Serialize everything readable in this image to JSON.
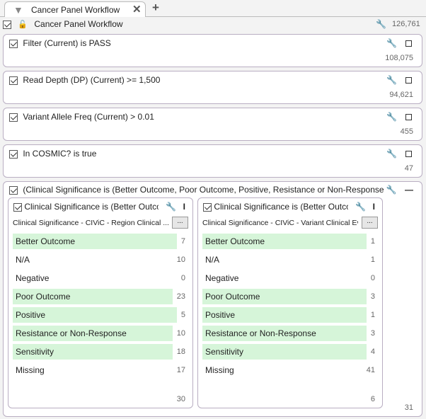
{
  "tab": {
    "title": "Cancer Panel Workflow",
    "close": "✕",
    "add": "+"
  },
  "root": {
    "label": "Cancer Panel Workflow",
    "count": "126,761"
  },
  "filters": [
    {
      "label": "Filter (Current) is PASS",
      "count": "108,075"
    },
    {
      "label": "Read Depth (DP) (Current) >= 1,500",
      "count": "94,621"
    },
    {
      "label": "Variant Allele Freq (Current) > 0.01",
      "count": "455"
    },
    {
      "label": "In COSMIC? is true",
      "count": "47"
    }
  ],
  "group": {
    "label": "(Clinical Significance is (Better Outcome, Poor Outcome, Positive, Resistance or Non-Response",
    "count": "31",
    "panels": [
      {
        "title": "Clinical Significance is (Better Outcome, Poor Outcome, Positive, Resistance or Non-Response, Sensitivity)",
        "field": "Clinical Significance - CIViC - Region Clinical ...",
        "more": "...",
        "total": "30",
        "rows": [
          {
            "label": "Better Outcome",
            "count": "7",
            "selected": true
          },
          {
            "label": "N/A",
            "count": "10",
            "selected": false
          },
          {
            "label": "Negative",
            "count": "0",
            "selected": false
          },
          {
            "label": "Poor Outcome",
            "count": "23",
            "selected": true
          },
          {
            "label": "Positive",
            "count": "5",
            "selected": true
          },
          {
            "label": "Resistance or Non-Response",
            "count": "10",
            "selected": true
          },
          {
            "label": "Sensitivity",
            "count": "18",
            "selected": true
          },
          {
            "label": "Missing",
            "count": "17",
            "selected": false
          }
        ]
      },
      {
        "title": "Clinical Significance is (Better Outcome, Poor Outcome, Positive, Resistance or Non-Response, Sensitivity)",
        "field": "Clinical Significance - CIViC - Variant Clinical Evidence...",
        "more": "...",
        "total": "6",
        "rows": [
          {
            "label": "Better Outcome",
            "count": "1",
            "selected": true
          },
          {
            "label": "N/A",
            "count": "1",
            "selected": false
          },
          {
            "label": "Negative",
            "count": "0",
            "selected": false
          },
          {
            "label": "Poor Outcome",
            "count": "3",
            "selected": true
          },
          {
            "label": "Positive",
            "count": "1",
            "selected": true
          },
          {
            "label": "Resistance or Non-Response",
            "count": "3",
            "selected": true
          },
          {
            "label": "Sensitivity",
            "count": "4",
            "selected": true
          },
          {
            "label": "Missing",
            "count": "41",
            "selected": false
          }
        ]
      }
    ]
  }
}
